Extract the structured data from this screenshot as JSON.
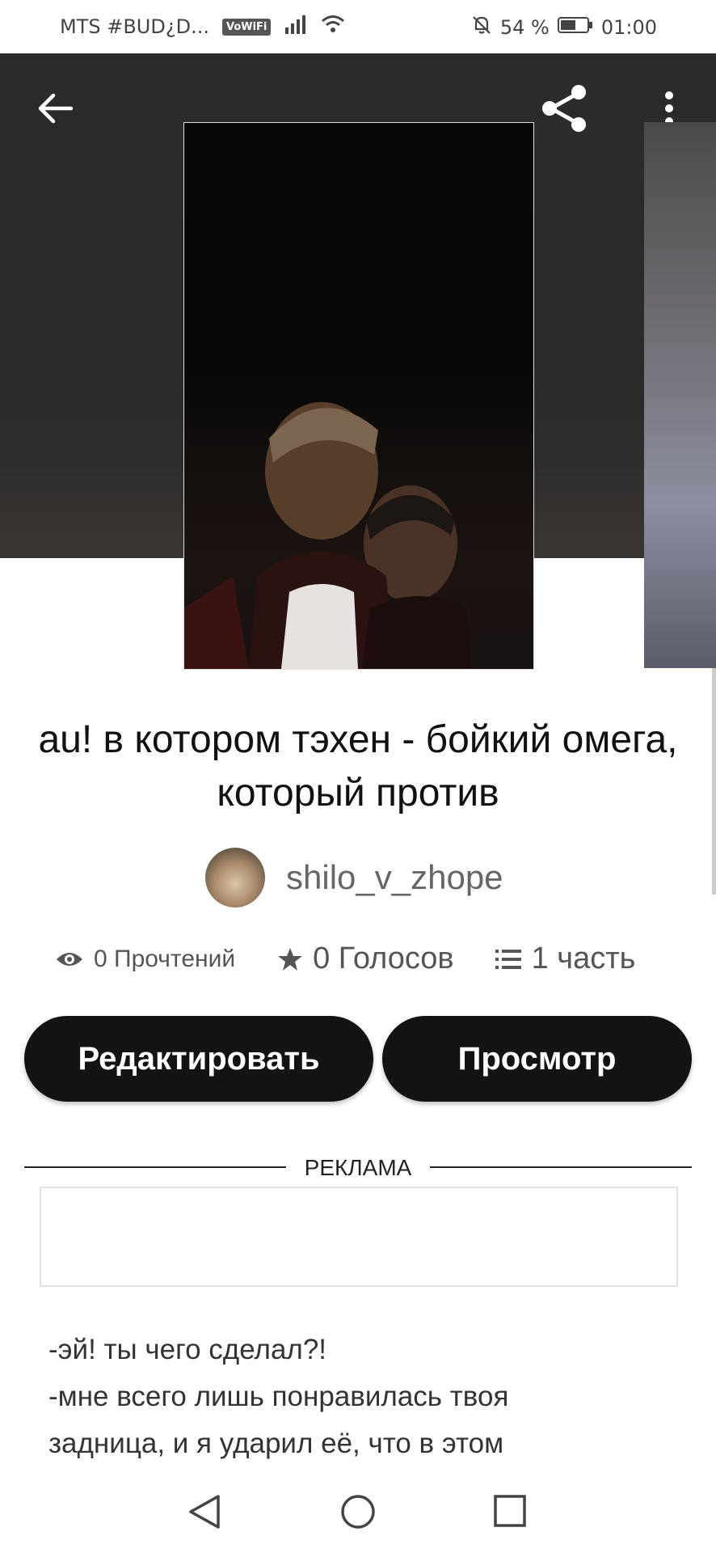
{
  "status_bar": {
    "carrier": "MTS #BUD¿D...",
    "vowifi_badge": "VoWiFi",
    "battery": "54 %",
    "time": "01:00"
  },
  "header": {
    "back_icon": "arrow-left-icon",
    "share_icon": "share-icon",
    "menu_icon": "more-vertical-icon"
  },
  "story": {
    "title": "au! в котором тэхен - бойкий омега, который против",
    "author": "shilo_v_zhope",
    "stats": {
      "reads": "0 Прочтений",
      "votes": "0 Голосов",
      "parts": "1 часть"
    },
    "text_lines": [
      "-эй! ты чего сделал?!",
      "-мне всего лишь понравилась твоя",
      "задница, и я ударил её, что в этом"
    ]
  },
  "actions": {
    "edit_label": "Редактировать",
    "view_label": "Просмотр"
  },
  "ad": {
    "label": "РЕКЛАМА"
  },
  "colors": {
    "hero_bg": "#2b2b2d",
    "button_bg": "#141214",
    "button_text": "#ffffff"
  }
}
